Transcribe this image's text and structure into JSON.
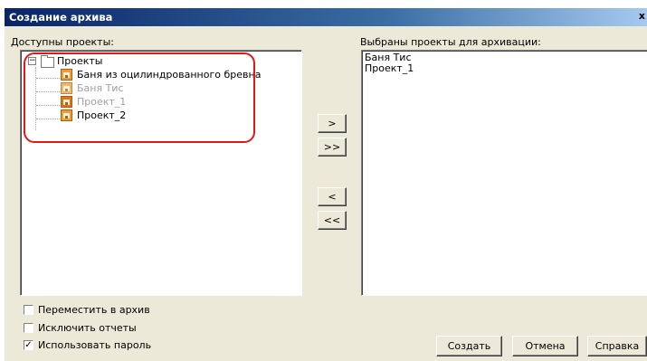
{
  "window": {
    "title": "Создание архива",
    "close_glyph": "x"
  },
  "available": {
    "label": "Доступны проекты:",
    "root": "Проекты",
    "root_expander": "−",
    "items": [
      {
        "label": "Баня из оцилиндрованного бревна",
        "state": "normal"
      },
      {
        "label": "Баня Тис",
        "state": "disabled"
      },
      {
        "label": "Проект_1",
        "state": "disabled"
      },
      {
        "label": "Проект_2",
        "state": "normal"
      }
    ]
  },
  "selected": {
    "label": "Выбраны проекты для архивации:",
    "items": [
      "Баня Тис",
      "Проект_1"
    ]
  },
  "transfer_buttons": {
    "add_one": ">",
    "add_all": ">>",
    "remove_one": "<",
    "remove_all": "<<"
  },
  "options": [
    {
      "label": "Переместить в архив",
      "checked": false
    },
    {
      "label": "Исключить отчеты",
      "checked": false
    },
    {
      "label": "Использовать пароль",
      "checked": true
    }
  ],
  "check_mark": "✓",
  "actions": {
    "create": "Создать",
    "cancel": "Отмена",
    "help": "Справка"
  },
  "colors": {
    "highlight": "#e01818",
    "icon_orange": "#f29b34",
    "titlebar": "#0a246a"
  }
}
